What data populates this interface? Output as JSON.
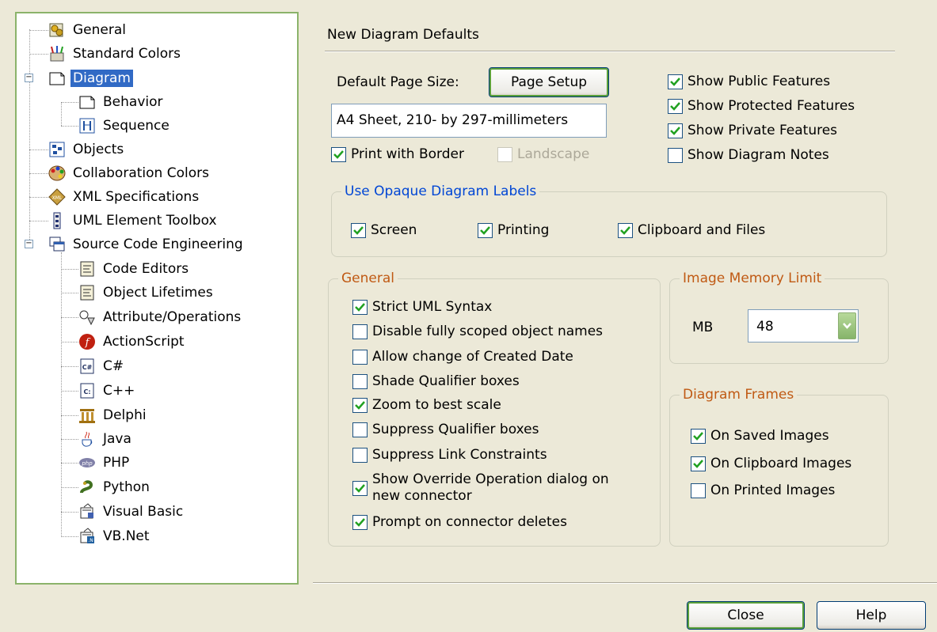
{
  "tree": {
    "items": [
      {
        "label": "General",
        "icon": "general-icon"
      },
      {
        "label": "Standard Colors",
        "icon": "paint-pots-icon"
      },
      {
        "label": "Diagram",
        "icon": "page-icon",
        "expander": "−"
      },
      {
        "label": "Behavior",
        "icon": "page-icon"
      },
      {
        "label": "Sequence",
        "icon": "sequence-icon"
      },
      {
        "label": "Objects",
        "icon": "objects-icon"
      },
      {
        "label": "Collaboration Colors",
        "icon": "palette-icon"
      },
      {
        "label": "XML Specifications",
        "icon": "xml-icon"
      },
      {
        "label": "UML Element Toolbox",
        "icon": "toolbox-icon"
      },
      {
        "label": "Source Code Engineering",
        "icon": "windows-icon",
        "expander": "−"
      },
      {
        "label": "Code Editors",
        "icon": "code-document-icon"
      },
      {
        "label": "Object Lifetimes",
        "icon": "code-document-icon"
      },
      {
        "label": "Attribute/Operations",
        "icon": "shapes-icon"
      },
      {
        "label": "ActionScript",
        "icon": "flash-icon"
      },
      {
        "label": "C#",
        "icon": "csharp-icon"
      },
      {
        "label": "C++",
        "icon": "cpp-icon"
      },
      {
        "label": "Delphi",
        "icon": "delphi-icon"
      },
      {
        "label": "Java",
        "icon": "java-icon"
      },
      {
        "label": "PHP",
        "icon": "php-icon"
      },
      {
        "label": "Python",
        "icon": "python-icon"
      },
      {
        "label": "Visual Basic",
        "icon": "visual-basic-icon"
      },
      {
        "label": "VB.Net",
        "icon": "vbnet-icon"
      }
    ]
  },
  "header": {
    "title": "New Diagram Defaults"
  },
  "page": {
    "size_label": "Default Page Size:",
    "setup_button": "Page Setup",
    "size_value": "A4 Sheet, 210- by 297-millimeters",
    "print_border": {
      "label": "Print with Border",
      "checked": true
    },
    "landscape": {
      "label": "Landscape",
      "checked": false,
      "disabled": true
    }
  },
  "features": [
    {
      "label": "Show Public Features",
      "checked": true
    },
    {
      "label": "Show Protected Features",
      "checked": true
    },
    {
      "label": "Show Private Features",
      "checked": true
    },
    {
      "label": "Show Diagram Notes",
      "checked": false
    }
  ],
  "opaque": {
    "title": "Use Opaque Diagram Labels",
    "screen": {
      "label": "Screen",
      "checked": true
    },
    "printing": {
      "label": "Printing",
      "checked": true
    },
    "clipboard": {
      "label": "Clipboard and Files",
      "checked": true
    }
  },
  "general": {
    "title": "General",
    "options": [
      {
        "label": "Strict UML Syntax",
        "checked": true
      },
      {
        "label": "Disable fully scoped object names",
        "checked": false
      },
      {
        "label": "Allow change of Created Date",
        "checked": false
      },
      {
        "label": "Shade Qualifier boxes",
        "checked": false
      },
      {
        "label": "Zoom to best scale",
        "checked": true
      },
      {
        "label": "Suppress Qualifier boxes",
        "checked": false
      },
      {
        "label": "Suppress Link Constraints",
        "checked": false
      },
      {
        "label": "Show Override Operation dialog on",
        "label2": "new connector",
        "checked": true
      },
      {
        "label": "Prompt on connector deletes",
        "checked": true
      }
    ]
  },
  "memory": {
    "title": "Image Memory Limit",
    "unit": "MB",
    "value": "48"
  },
  "frames": {
    "title": "Diagram Frames",
    "options": [
      {
        "label": "On Saved Images",
        "checked": true
      },
      {
        "label": "On Clipboard Images",
        "checked": true
      },
      {
        "label": "On Printed Images",
        "checked": false
      }
    ]
  },
  "footer": {
    "close": "Close",
    "help": "Help"
  },
  "colors": {
    "accent_blue": "#0046d5",
    "accent_brown": "#c05a14",
    "selection": "#316ac5",
    "dialog_bg": "#ece9d8"
  }
}
